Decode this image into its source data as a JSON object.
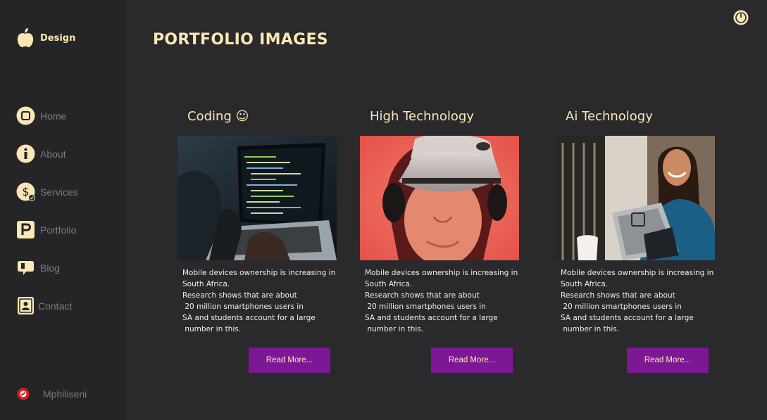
{
  "brand": {
    "label": "Design",
    "icon": "apple-icon"
  },
  "nav": [
    {
      "label": "Home",
      "icon": "home-square-icon"
    },
    {
      "label": "About",
      "icon": "info-icon"
    },
    {
      "label": "Services",
      "icon": "dollar-icon"
    },
    {
      "label": "Portfolio",
      "icon": "portfolio-p-icon"
    },
    {
      "label": "Blog",
      "icon": "blog-icon"
    },
    {
      "label": "Contact",
      "icon": "contact-book-icon"
    }
  ],
  "user": {
    "name": "Mphiliseni",
    "icon": "avatar-icon"
  },
  "page_title": "PORTFOLIO IMAGES",
  "cards": [
    {
      "title": "Coding ☺",
      "text": "Mobile devices ownership is increasing in\nSouth Africa.\nResearch shows that are about\n 20 million smartphones users in\nSA and students account for a large\n number in this.",
      "button": "Read More...",
      "image": "coding-laptop-image"
    },
    {
      "title": "High Technology",
      "text": "Mobile devices ownership is increasing in\nSouth Africa.\nResearch shows that are about\n 20 million smartphones users in\nSA and students account for a large\n number in this.",
      "button": "Read More...",
      "image": "vr-headset-image"
    },
    {
      "title": "Ai Technology",
      "text": "Mobile devices ownership is increasing in\nSouth Africa.\nResearch shows that are about\n 20 million smartphones users in\nSA and students account for a large\n number in this.",
      "button": "Read More...",
      "image": "woman-with-device-image"
    }
  ],
  "colors": {
    "background": "#2a292b",
    "sidebar": "#252426",
    "accent_text": "#fbe7b6",
    "button": "#7d1895"
  }
}
